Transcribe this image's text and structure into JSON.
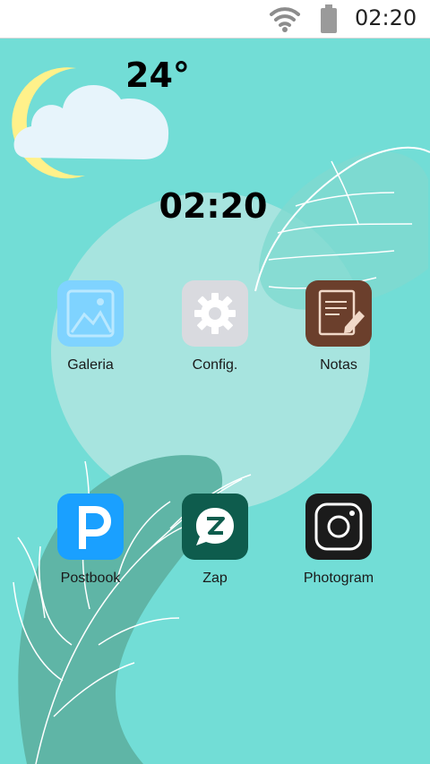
{
  "status_bar": {
    "time": "02:20",
    "icons": [
      "wifi-icon",
      "battery-icon"
    ]
  },
  "weather": {
    "temperature": "24°",
    "icon": "moon-cloud-icon"
  },
  "clock": "02:20",
  "apps": [
    {
      "label": "Galeria",
      "icon": "gallery-icon",
      "color": "#7fd3ff"
    },
    {
      "label": "Config.",
      "icon": "gear-icon",
      "color": "#d9dadf"
    },
    {
      "label": "Notas",
      "icon": "notes-icon",
      "color": "#6b3f2c"
    },
    {
      "label": "Postbook",
      "icon": "postbook-icon",
      "color": "#1aa0ff"
    },
    {
      "label": "Zap",
      "icon": "zap-icon",
      "color": "#0e5c4d"
    },
    {
      "label": "Photogram",
      "icon": "camera-icon",
      "color": "#1b1b1b"
    }
  ],
  "colors": {
    "background": "#72ddd6",
    "circle": "#a7e4df",
    "leaf_shape": "#5fb5a6",
    "moon": "#fff18a",
    "cloud": "#e7f4fb"
  }
}
